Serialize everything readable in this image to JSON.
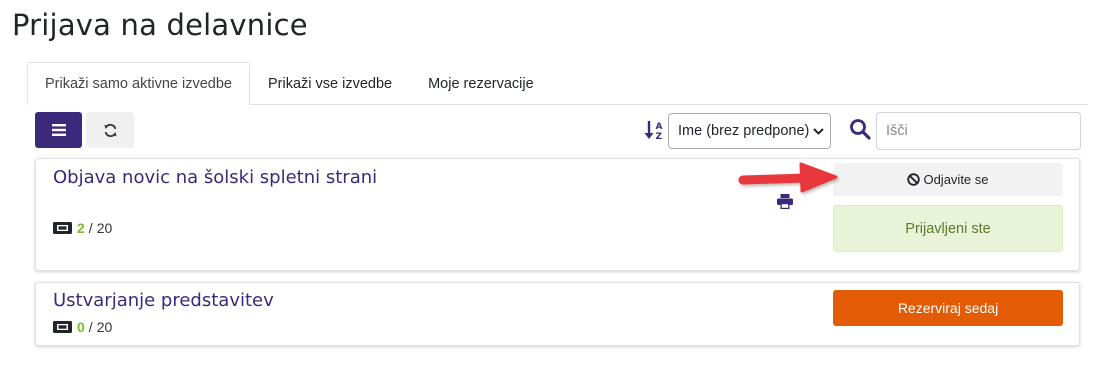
{
  "page": {
    "title": "Prijava na delavnice"
  },
  "tabs": [
    {
      "label": "Prikaži samo aktivne izvedbe",
      "active": true
    },
    {
      "label": "Prikaži vse izvedbe",
      "active": false
    },
    {
      "label": "Moje rezervacije",
      "active": false
    }
  ],
  "toolbar": {
    "menu_icon": "list-icon",
    "refresh_icon": "refresh-icon",
    "sort_icon": "sort-alpha-icon",
    "sort_selected": "Ime (brez predpone)",
    "search_placeholder": "Išči"
  },
  "workshops": [
    {
      "title": "Objava novic na šolski spletni strani",
      "taken": "2",
      "capacity": "20",
      "unsubscribe_label": "Odjavite se",
      "status_label": "Prijavljeni ste"
    },
    {
      "title": "Ustvarjanje predstavitev",
      "taken": "0",
      "capacity": "20",
      "reserve_label": "Rezerviraj sedaj"
    }
  ],
  "colors": {
    "brand": "#3b2a7c",
    "accent_orange": "#e35c05",
    "success_bg": "#e8f3d7",
    "count_green": "#7dbb2a",
    "arrow_red": "#e8373e"
  }
}
